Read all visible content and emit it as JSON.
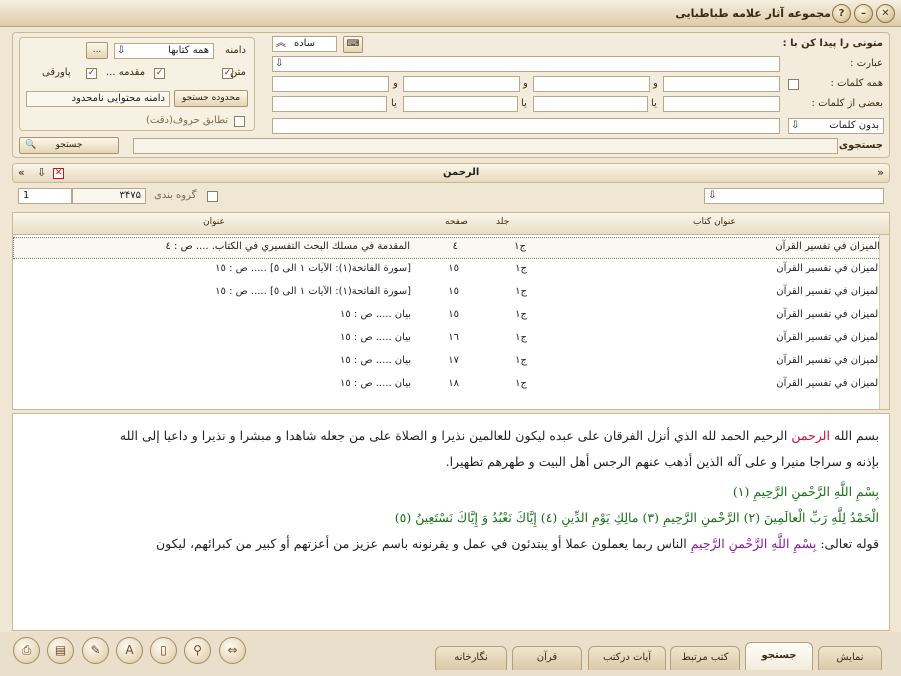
{
  "window": {
    "title": "مجموعه آثار علامه طباطبایی"
  },
  "search": {
    "header_label": "متونی را پیدا کن با :",
    "mode_value": "ساده",
    "phrase_label": "عبارت :",
    "all_words_label": "همه کلمات :",
    "some_words_label": "بعضی از کلمات :",
    "without_words_label": "بدون کلمات",
    "and_word": "و",
    "or_word": "یا",
    "search_label": "جستجوی",
    "search_button": "جستجو"
  },
  "scope": {
    "label": "دامنه",
    "value": "همه کتابها",
    "more_button": "...",
    "text_label": "متن",
    "intro_label": "مقدمه ...",
    "footnote_label": "پاورقی",
    "range_button": "محدوده جستجو",
    "range_value": "دامنه محتوایی نامحدود",
    "exact_match_label": "تطابق حروف(دقت)"
  },
  "results": {
    "query_text": "الرحمن",
    "count": "۳۴۷۵",
    "page": "1",
    "grouping_label": "گروه بندی",
    "columns": {
      "book": "عنوان کتاب",
      "volume": "جلد",
      "page": "صفحه",
      "title": "عنوان"
    },
    "rows": [
      {
        "book": "الميزان في تفسير القرآن",
        "volume": "ج۱",
        "page": "٤",
        "title": "المقدمة في مسلك البحث التفسيري في الكتاب. .... ص : ٤"
      },
      {
        "book": "الميزان في تفسير القرآن",
        "volume": "ج۱",
        "page": "١٥",
        "title": "[سورة الفاتحة(١): الآيات ١ الى ٥] ..... ص : ١٥"
      },
      {
        "book": "الميزان في تفسير القرآن",
        "volume": "ج۱",
        "page": "١٥",
        "title": "[سورة الفاتحة(١): الآيات ١ الى ٥] ..... ص : ١٥"
      },
      {
        "book": "الميزان في تفسير القرآن",
        "volume": "ج۱",
        "page": "١٥",
        "title": "بيان ..... ص : ١٥"
      },
      {
        "book": "الميزان في تفسير القرآن",
        "volume": "ج۱",
        "page": "١٦",
        "title": "بيان ..... ص : ١٥"
      },
      {
        "book": "الميزان في تفسير القرآن",
        "volume": "ج۱",
        "page": "١٧",
        "title": "بيان ..... ص : ١٥"
      },
      {
        "book": "الميزان في تفسير القرآن",
        "volume": "ج۱",
        "page": "١٨",
        "title": "بيان ..... ص : ١٥"
      }
    ]
  },
  "content": {
    "p1_start": "بسم الله ",
    "p1_highlight": "الرحمن",
    "p1_rest": " الرحيم الحمد لله الذي أنزل الفرقان على عبده ليكون للعالمين نذيرا و الصلاة على من جعله شاهدا و مبشرا و نذيرا و داعيا إلى الله",
    "p2": "بإذنه و سراجا منيرا و على آله الذين أذهب عنهم الرجس أهل البيت و طهرهم تطهيرا.",
    "verse1": "بِسْمِ اللَّهِ الرَّحْمنِ الرَّحِيمِ (١)",
    "verse2": "الْحَمْدُ لِلَّهِ رَبِّ الْعالَمِينَ (٢) الرَّحْمنِ الرَّحِيمِ (٣) مالِكِ يَوْمِ الدِّينِ (٤) إِيَّاكَ نَعْبُدُ وَ إِيَّاكَ نَسْتَعِينُ (٥)",
    "p3_start": "قوله تعالى: ",
    "p3_verse": "بِسْمِ اللَّهِ الرَّحْمنِ الرَّحِيمِ",
    "p3_rest": " الناس ربما يعملون عملا أو يبتدئون في عمل و يقرنونه باسم عزيز من أعزتهم أو كبير من كبرائهم، ليكون"
  },
  "tabs": [
    {
      "label": "نمایش"
    },
    {
      "label": "جستجو"
    },
    {
      "label": "کتب مرتبط"
    },
    {
      "label": "آیات درکتب"
    },
    {
      "label": "قرآن"
    },
    {
      "label": "نگارخانه"
    }
  ],
  "colors": {
    "accent": "#c01040",
    "verse": "#187018",
    "highlight": "#8a1a9a"
  }
}
